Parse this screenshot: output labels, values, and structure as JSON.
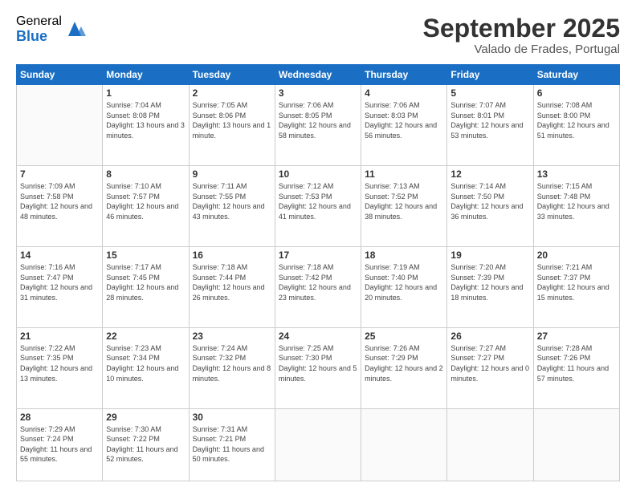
{
  "logo": {
    "general": "General",
    "blue": "Blue"
  },
  "header": {
    "month": "September 2025",
    "location": "Valado de Frades, Portugal"
  },
  "days_of_week": [
    "Sunday",
    "Monday",
    "Tuesday",
    "Wednesday",
    "Thursday",
    "Friday",
    "Saturday"
  ],
  "weeks": [
    [
      {
        "day": "",
        "sunrise": "",
        "sunset": "",
        "daylight": ""
      },
      {
        "day": "1",
        "sunrise": "Sunrise: 7:04 AM",
        "sunset": "Sunset: 8:08 PM",
        "daylight": "Daylight: 13 hours and 3 minutes."
      },
      {
        "day": "2",
        "sunrise": "Sunrise: 7:05 AM",
        "sunset": "Sunset: 8:06 PM",
        "daylight": "Daylight: 13 hours and 1 minute."
      },
      {
        "day": "3",
        "sunrise": "Sunrise: 7:06 AM",
        "sunset": "Sunset: 8:05 PM",
        "daylight": "Daylight: 12 hours and 58 minutes."
      },
      {
        "day": "4",
        "sunrise": "Sunrise: 7:06 AM",
        "sunset": "Sunset: 8:03 PM",
        "daylight": "Daylight: 12 hours and 56 minutes."
      },
      {
        "day": "5",
        "sunrise": "Sunrise: 7:07 AM",
        "sunset": "Sunset: 8:01 PM",
        "daylight": "Daylight: 12 hours and 53 minutes."
      },
      {
        "day": "6",
        "sunrise": "Sunrise: 7:08 AM",
        "sunset": "Sunset: 8:00 PM",
        "daylight": "Daylight: 12 hours and 51 minutes."
      }
    ],
    [
      {
        "day": "7",
        "sunrise": "Sunrise: 7:09 AM",
        "sunset": "Sunset: 7:58 PM",
        "daylight": "Daylight: 12 hours and 48 minutes."
      },
      {
        "day": "8",
        "sunrise": "Sunrise: 7:10 AM",
        "sunset": "Sunset: 7:57 PM",
        "daylight": "Daylight: 12 hours and 46 minutes."
      },
      {
        "day": "9",
        "sunrise": "Sunrise: 7:11 AM",
        "sunset": "Sunset: 7:55 PM",
        "daylight": "Daylight: 12 hours and 43 minutes."
      },
      {
        "day": "10",
        "sunrise": "Sunrise: 7:12 AM",
        "sunset": "Sunset: 7:53 PM",
        "daylight": "Daylight: 12 hours and 41 minutes."
      },
      {
        "day": "11",
        "sunrise": "Sunrise: 7:13 AM",
        "sunset": "Sunset: 7:52 PM",
        "daylight": "Daylight: 12 hours and 38 minutes."
      },
      {
        "day": "12",
        "sunrise": "Sunrise: 7:14 AM",
        "sunset": "Sunset: 7:50 PM",
        "daylight": "Daylight: 12 hours and 36 minutes."
      },
      {
        "day": "13",
        "sunrise": "Sunrise: 7:15 AM",
        "sunset": "Sunset: 7:48 PM",
        "daylight": "Daylight: 12 hours and 33 minutes."
      }
    ],
    [
      {
        "day": "14",
        "sunrise": "Sunrise: 7:16 AM",
        "sunset": "Sunset: 7:47 PM",
        "daylight": "Daylight: 12 hours and 31 minutes."
      },
      {
        "day": "15",
        "sunrise": "Sunrise: 7:17 AM",
        "sunset": "Sunset: 7:45 PM",
        "daylight": "Daylight: 12 hours and 28 minutes."
      },
      {
        "day": "16",
        "sunrise": "Sunrise: 7:18 AM",
        "sunset": "Sunset: 7:44 PM",
        "daylight": "Daylight: 12 hours and 26 minutes."
      },
      {
        "day": "17",
        "sunrise": "Sunrise: 7:18 AM",
        "sunset": "Sunset: 7:42 PM",
        "daylight": "Daylight: 12 hours and 23 minutes."
      },
      {
        "day": "18",
        "sunrise": "Sunrise: 7:19 AM",
        "sunset": "Sunset: 7:40 PM",
        "daylight": "Daylight: 12 hours and 20 minutes."
      },
      {
        "day": "19",
        "sunrise": "Sunrise: 7:20 AM",
        "sunset": "Sunset: 7:39 PM",
        "daylight": "Daylight: 12 hours and 18 minutes."
      },
      {
        "day": "20",
        "sunrise": "Sunrise: 7:21 AM",
        "sunset": "Sunset: 7:37 PM",
        "daylight": "Daylight: 12 hours and 15 minutes."
      }
    ],
    [
      {
        "day": "21",
        "sunrise": "Sunrise: 7:22 AM",
        "sunset": "Sunset: 7:35 PM",
        "daylight": "Daylight: 12 hours and 13 minutes."
      },
      {
        "day": "22",
        "sunrise": "Sunrise: 7:23 AM",
        "sunset": "Sunset: 7:34 PM",
        "daylight": "Daylight: 12 hours and 10 minutes."
      },
      {
        "day": "23",
        "sunrise": "Sunrise: 7:24 AM",
        "sunset": "Sunset: 7:32 PM",
        "daylight": "Daylight: 12 hours and 8 minutes."
      },
      {
        "day": "24",
        "sunrise": "Sunrise: 7:25 AM",
        "sunset": "Sunset: 7:30 PM",
        "daylight": "Daylight: 12 hours and 5 minutes."
      },
      {
        "day": "25",
        "sunrise": "Sunrise: 7:26 AM",
        "sunset": "Sunset: 7:29 PM",
        "daylight": "Daylight: 12 hours and 2 minutes."
      },
      {
        "day": "26",
        "sunrise": "Sunrise: 7:27 AM",
        "sunset": "Sunset: 7:27 PM",
        "daylight": "Daylight: 12 hours and 0 minutes."
      },
      {
        "day": "27",
        "sunrise": "Sunrise: 7:28 AM",
        "sunset": "Sunset: 7:26 PM",
        "daylight": "Daylight: 11 hours and 57 minutes."
      }
    ],
    [
      {
        "day": "28",
        "sunrise": "Sunrise: 7:29 AM",
        "sunset": "Sunset: 7:24 PM",
        "daylight": "Daylight: 11 hours and 55 minutes."
      },
      {
        "day": "29",
        "sunrise": "Sunrise: 7:30 AM",
        "sunset": "Sunset: 7:22 PM",
        "daylight": "Daylight: 11 hours and 52 minutes."
      },
      {
        "day": "30",
        "sunrise": "Sunrise: 7:31 AM",
        "sunset": "Sunset: 7:21 PM",
        "daylight": "Daylight: 11 hours and 50 minutes."
      },
      {
        "day": "",
        "sunrise": "",
        "sunset": "",
        "daylight": ""
      },
      {
        "day": "",
        "sunrise": "",
        "sunset": "",
        "daylight": ""
      },
      {
        "day": "",
        "sunrise": "",
        "sunset": "",
        "daylight": ""
      },
      {
        "day": "",
        "sunrise": "",
        "sunset": "",
        "daylight": ""
      }
    ]
  ]
}
